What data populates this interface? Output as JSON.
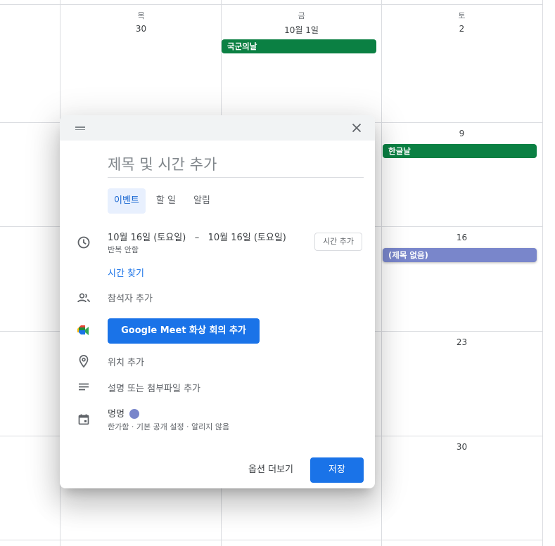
{
  "calendar": {
    "day_headers": [
      "목",
      "금",
      "토"
    ],
    "week1_dates": [
      "30",
      "10월 1일",
      "2"
    ],
    "sat_dates": [
      "9",
      "16",
      "23",
      "30"
    ],
    "events": {
      "armed_forces_day": "국군의날",
      "hangul_day": "한글날",
      "untitled": "(제목 없음)"
    },
    "colors": {
      "holiday": "#0b8043",
      "event": "#7986cb",
      "accent": "#1a73e8"
    }
  },
  "dialog": {
    "title_placeholder": "제목 및 시간 추가",
    "tabs": [
      "이벤트",
      "할 일",
      "알림"
    ],
    "date_range": "10월 16일 (토요일)   –   10월 16일 (토요일)",
    "recurrence": "반복 안함",
    "add_time_button": "시간 추가",
    "find_time_link": "시간 찾기",
    "guests": "참석자 추가",
    "meet_button": "Google Meet 화상 회의 추가",
    "location": "위치 추가",
    "description": "설명 또는 첨부파일 추가",
    "calendar_name": "멍멍",
    "calendar_settings": "한가함 · 기본 공개 설정 · 알리지 않음",
    "more_options": "옵션 더보기",
    "save": "저장"
  },
  "icons": [
    "drag-handle-icon",
    "close-icon",
    "clock-icon",
    "people-icon",
    "google-meet-icon",
    "location-pin-icon",
    "notes-icon",
    "calendar-icon"
  ]
}
